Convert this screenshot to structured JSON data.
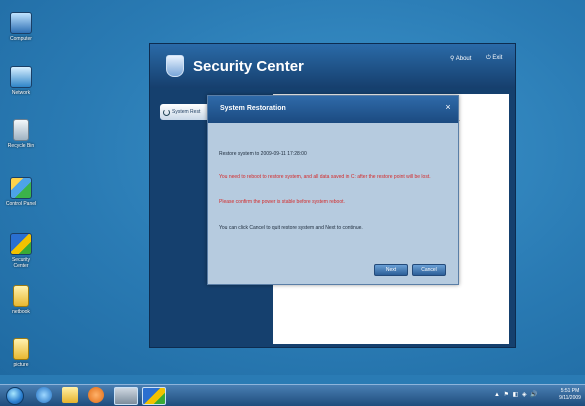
{
  "desktop": {
    "icons": [
      {
        "label": "Computer"
      },
      {
        "label": "Network"
      },
      {
        "label": "Recycle Bin"
      },
      {
        "label": "Control Panel"
      },
      {
        "label": "Security Center"
      },
      {
        "label": "netbook"
      },
      {
        "label": "picture"
      }
    ]
  },
  "security_center": {
    "title": "Security Center",
    "about_label": "About",
    "exit_label": "Exit",
    "sidebar_item": "System Rest",
    "content_tail": "n."
  },
  "dialog": {
    "title": "System Restoration",
    "close_glyph": "×",
    "restore_line": "Restore system to 2009-09-11 17:28:00",
    "warning_1": "You need to reboot to restore system, and all data saved in C: after the restore point will be lost.",
    "warning_2": "Please confirm the power is stable before system reboot.",
    "info": "You can click Cancel to quit restore system and Next to continue.",
    "next_label": "Next",
    "cancel_label": "Cancel"
  },
  "taskbar": {
    "tray_icons": "▲ ⚑ ◧ ◈ 🔊",
    "clock_time": "5:51 PM",
    "clock_date": "9/11/2009"
  }
}
